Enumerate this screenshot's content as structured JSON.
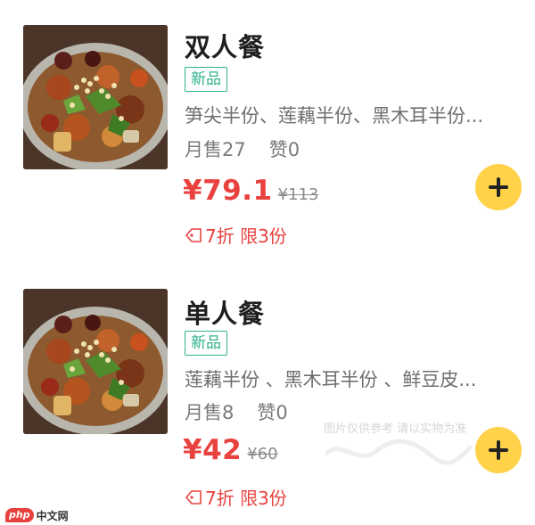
{
  "items": [
    {
      "title": "双人餐",
      "badge": "新品",
      "description": "笋尖半份、莲藕半份、黑木耳半份...",
      "sales": "月售27",
      "likes": "赞0",
      "price": "¥79.1",
      "original_price": "¥113",
      "promo": "7折 限3份",
      "image_icon": "dry-pot-dish-photo",
      "add_icon": "plus-icon"
    },
    {
      "title": "单人餐",
      "badge": "新品",
      "description": "莲藕半份 、黑木耳半份 、鲜豆皮...",
      "sales": "月售8",
      "likes": "赞0",
      "price": "¥42",
      "original_price": "¥60",
      "promo": "7折 限3份",
      "image_icon": "dry-pot-dish-photo",
      "add_icon": "plus-icon"
    }
  ],
  "watermark": {
    "note": "图片仅供参考 请以实物为准"
  },
  "site_logo": {
    "mark": "php",
    "name": "中文网"
  },
  "colors": {
    "price": "#e8413e",
    "badge": "#2fb38c",
    "add_button": "#ffd24a"
  }
}
